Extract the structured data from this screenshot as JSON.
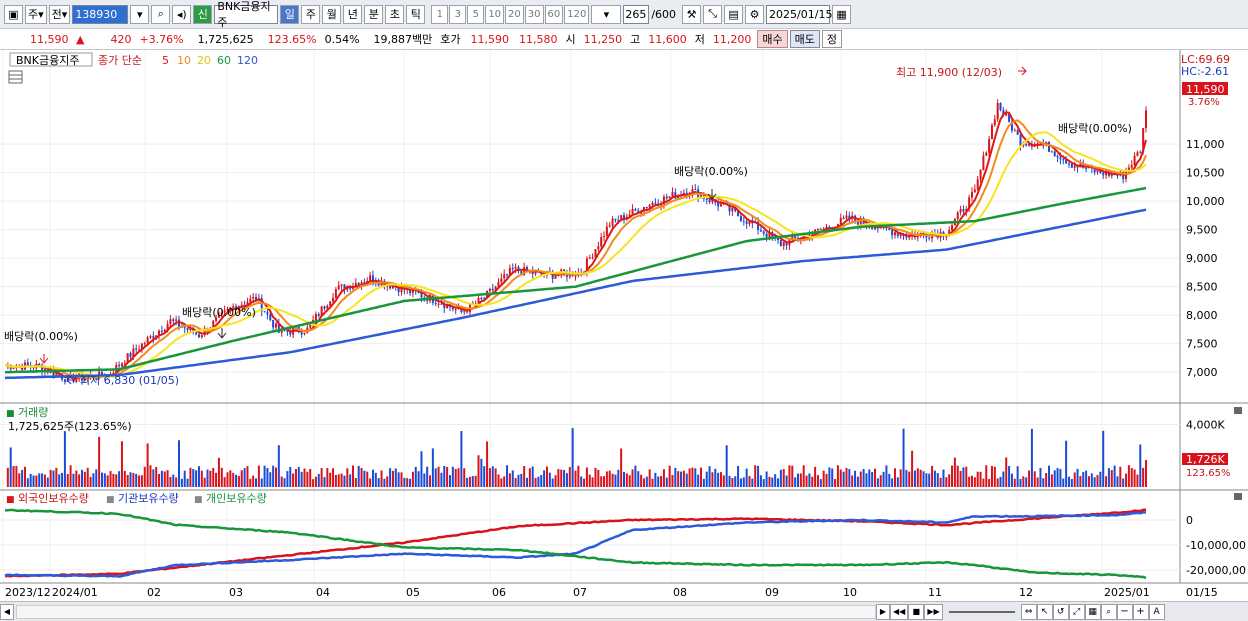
{
  "toolbar": {
    "market_type": "주",
    "prev_label": "전",
    "code": "138930",
    "stock_name": "BNK금융지주",
    "shin_label": "신",
    "periods": [
      "일",
      "주",
      "월",
      "년",
      "분",
      "초",
      "틱"
    ],
    "active_period": "일",
    "nums": [
      "1",
      "3",
      "5",
      "10",
      "20",
      "30",
      "60",
      "120"
    ],
    "count": "265",
    "max": "/600",
    "date": "2025/01/15"
  },
  "quote": {
    "price": "11,590",
    "change": "420",
    "pct": "+3.76%",
    "volume": "1,725,625",
    "vol_ratio": "123.65%",
    "turnover": "0.54%",
    "amount": "19,887백만",
    "ask_label": "호가",
    "ask": "11,590",
    "bid": "11,580",
    "open_label": "시",
    "open": "11,250",
    "high_label": "고",
    "high": "11,600",
    "low_label": "저",
    "low": "11,200",
    "buy": "매수",
    "sell": "매도",
    "flat": "정"
  },
  "legend": {
    "title": "BNK금융지주",
    "ma_label": "종가 단순",
    "ma": [
      {
        "p": "5",
        "color": "#e01818"
      },
      {
        "p": "10",
        "color": "#f08c1c"
      },
      {
        "p": "20",
        "color": "#f0e21c"
      },
      {
        "p": "60",
        "color": "#19963c"
      },
      {
        "p": "120",
        "color": "#2c5ad8"
      }
    ]
  },
  "annotations": {
    "high": "최고 11,900 (12/03)",
    "low": "최저 6,830 (01/05)",
    "div1": "배당락(0.00%)",
    "div2": "배당락(0.00%)",
    "div3": "배당락(0.00%)",
    "div4": "배당락(0.00%)"
  },
  "right_info": {
    "lc": "LC:69.69",
    "hc": "HC:-2.61",
    "price_tag": "11,590",
    "pct": "3.76%",
    "vol_tag": "1,726K",
    "vol_pct": "123.65%"
  },
  "volume_panel": {
    "title": "거래량",
    "value": "1,725,625주(123.65%)"
  },
  "holding_panel": {
    "s1": "외국인보유수량",
    "s2": "기관보유수량",
    "s3": "개인보유수량",
    "colors": [
      "#d8131b",
      "#2c5ad8",
      "#19963c"
    ]
  },
  "chart_data": [
    {
      "type": "line",
      "title": "BNK금융지주",
      "ylim": [
        6600,
        12300
      ],
      "y_ticks": [
        "11,000",
        "10,500",
        "10,000",
        "9,500",
        "9,000",
        "8,500",
        "8,000",
        "7,500",
        "7,000"
      ],
      "y_tick_values": [
        11000,
        10500,
        10000,
        9500,
        9000,
        8500,
        8000,
        7500,
        7000
      ],
      "x_labels": [
        "2023/12",
        "2024/01",
        "02",
        "03",
        "04",
        "05",
        "06",
        "07",
        "08",
        "09",
        "10",
        "11",
        "12",
        "2025/01",
        "01/15"
      ],
      "close_anchors": [
        [
          0,
          7120
        ],
        [
          12,
          7100
        ],
        [
          22,
          6880
        ],
        [
          36,
          6950
        ],
        [
          46,
          7400
        ],
        [
          58,
          7900
        ],
        [
          68,
          7650
        ],
        [
          80,
          8150
        ],
        [
          88,
          8300
        ],
        [
          96,
          7700
        ],
        [
          106,
          7750
        ],
        [
          116,
          8450
        ],
        [
          128,
          8650
        ],
        [
          140,
          8450
        ],
        [
          152,
          8250
        ],
        [
          160,
          8050
        ],
        [
          168,
          8300
        ],
        [
          178,
          8800
        ],
        [
          190,
          8700
        ],
        [
          202,
          8750
        ],
        [
          212,
          9600
        ],
        [
          226,
          9950
        ],
        [
          240,
          10200
        ],
        [
          252,
          9900
        ],
        [
          262,
          9600
        ],
        [
          272,
          9250
        ],
        [
          284,
          9450
        ],
        [
          296,
          9700
        ],
        [
          306,
          9550
        ],
        [
          316,
          9400
        ],
        [
          330,
          9450
        ],
        [
          340,
          10150
        ],
        [
          348,
          11700
        ],
        [
          356,
          11050
        ],
        [
          364,
          11000
        ],
        [
          374,
          10650
        ],
        [
          384,
          10500
        ],
        [
          392,
          10450
        ],
        [
          398,
          10900
        ],
        [
          400,
          11590
        ]
      ],
      "ma60_anchors": [
        [
          0,
          7000
        ],
        [
          40,
          7050
        ],
        [
          80,
          7550
        ],
        [
          140,
          8250
        ],
        [
          200,
          8500
        ],
        [
          260,
          9300
        ],
        [
          300,
          9550
        ],
        [
          340,
          9650
        ],
        [
          370,
          9950
        ],
        [
          400,
          10230
        ]
      ],
      "ma120_anchors": [
        [
          0,
          6900
        ],
        [
          40,
          6950
        ],
        [
          100,
          7350
        ],
        [
          160,
          7950
        ],
        [
          220,
          8600
        ],
        [
          280,
          8950
        ],
        [
          330,
          9150
        ],
        [
          360,
          9450
        ],
        [
          400,
          9850
        ]
      ]
    },
    {
      "type": "bar",
      "title": "거래량",
      "y_ticks": [
        "4,000K"
      ],
      "y_tick_values": [
        4000
      ]
    },
    {
      "type": "line",
      "title": "외국인보유수량 기관보유수량 개인보유수량",
      "y_ticks": [
        "0",
        "-10,000,00",
        "-20,000,00"
      ],
      "series": [
        {
          "name": "외국인보유수량",
          "anchors": [
            [
              0,
              -22.5
            ],
            [
              40,
              -21.5
            ],
            [
              60,
              -19
            ],
            [
              100,
              -14
            ],
            [
              140,
              -9
            ],
            [
              180,
              -2.5
            ],
            [
              220,
              0
            ],
            [
              260,
              0.5
            ],
            [
              300,
              -0.5
            ],
            [
              330,
              -2
            ],
            [
              360,
              0.5
            ],
            [
              390,
              3
            ],
            [
              400,
              4
            ]
          ]
        },
        {
          "name": "기관보유수량",
          "anchors": [
            [
              0,
              -22
            ],
            [
              40,
              -22.5
            ],
            [
              60,
              -18
            ],
            [
              100,
              -16
            ],
            [
              140,
              -13.5
            ],
            [
              180,
              -15
            ],
            [
              200,
              -13.5
            ],
            [
              220,
              -4
            ],
            [
              260,
              -1
            ],
            [
              300,
              0
            ],
            [
              330,
              -1
            ],
            [
              340,
              1.5
            ],
            [
              360,
              1.5
            ],
            [
              390,
              2
            ],
            [
              400,
              3
            ]
          ]
        },
        {
          "name": "개인보유수량",
          "anchors": [
            [
              0,
              4
            ],
            [
              40,
              2.5
            ],
            [
              60,
              -2
            ],
            [
              100,
              -5
            ],
            [
              140,
              -11
            ],
            [
              180,
              -12
            ],
            [
              220,
              -17
            ],
            [
              260,
              -18
            ],
            [
              300,
              -18
            ],
            [
              330,
              -17
            ],
            [
              340,
              -18
            ],
            [
              360,
              -21
            ],
            [
              390,
              -22
            ],
            [
              400,
              -23
            ]
          ]
        }
      ]
    }
  ]
}
